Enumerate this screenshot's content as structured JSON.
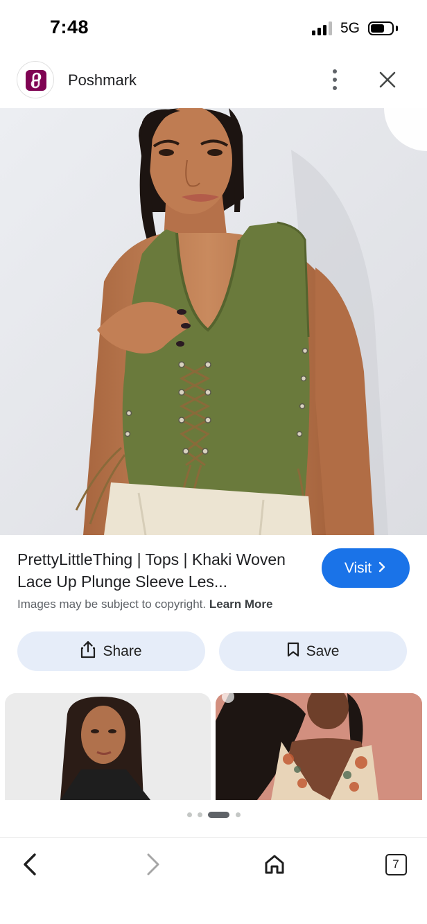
{
  "status_bar": {
    "time": "7:48",
    "network": "5G"
  },
  "header": {
    "site_name": "Poshmark",
    "logo_letter": "P"
  },
  "hero": {
    "image_alt": "Model wearing khaki lace up plunge sleeveless top"
  },
  "result": {
    "title": "PrettyLittleThing | Tops | Khaki Woven Lace Up Plunge Sleeve Les...",
    "visit_label": "Visit",
    "copyright_text": "Images may be subject to copyright.",
    "learn_more": "Learn More"
  },
  "actions": {
    "share_label": "Share",
    "save_label": "Save"
  },
  "related": {
    "thumbs": [
      {
        "alt": "Woman with long dark hair in black top"
      },
      {
        "alt": "Woman in floral plunge top on pink background"
      }
    ]
  },
  "pagination": {
    "total": 4,
    "active_index": 2
  },
  "toolbar": {
    "tab_count": "7"
  },
  "colors": {
    "accent": "#1a73e8",
    "action_bg": "#e6edf9",
    "brand": "#7f0353",
    "garment": "#6a7a3c"
  },
  "icons": [
    "signal-icon",
    "battery-icon",
    "kebab-menu-icon",
    "close-icon",
    "chevron-right-icon",
    "share-icon",
    "bookmark-icon",
    "back-arrow-icon",
    "forward-arrow-icon",
    "home-icon",
    "tabs-icon"
  ]
}
